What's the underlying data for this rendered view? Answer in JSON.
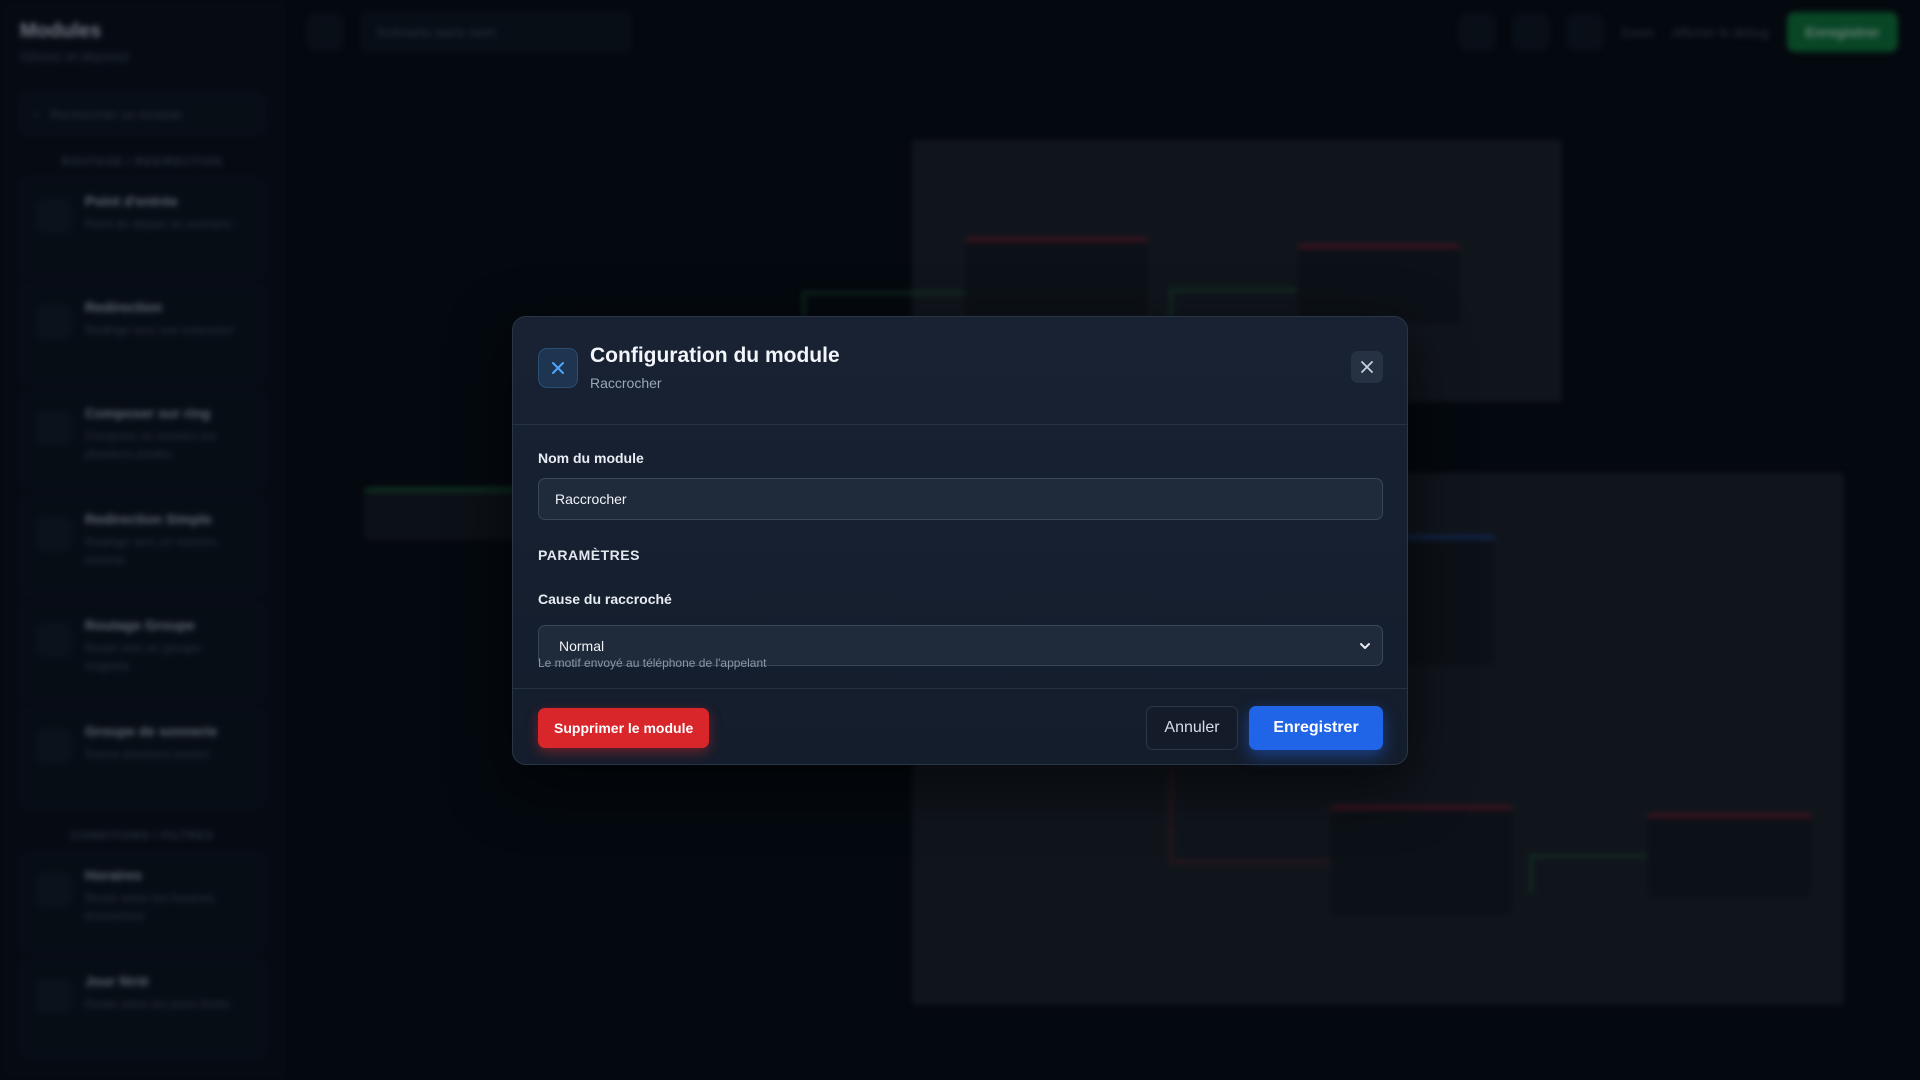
{
  "background": {
    "sidebar": {
      "title": "Modules",
      "subtitle": "Glissez et déposez",
      "search_placeholder": "Rechercher un module",
      "section_routing": "ROUTAGE / REDIRECTION",
      "section_conditions": "CONDITIONS / FILTRES",
      "items": [
        {
          "name": "Point d'entrée",
          "desc": "Point de départ du scénario"
        },
        {
          "name": "Redirection",
          "desc": "Redirige vers une extension"
        },
        {
          "name": "Composer sur ring",
          "desc": "Compose un numéro sur plusieurs postes"
        },
        {
          "name": "Redirection Simple",
          "desc": "Redirige vers un numéro externe"
        },
        {
          "name": "Routage Groupe",
          "desc": "Route vers un groupe d'agents"
        },
        {
          "name": "Groupe de sonnerie",
          "desc": "Sonne plusieurs postes"
        },
        {
          "name": "Horaires",
          "desc": "Route selon les horaires d'ouverture"
        },
        {
          "name": "Jour férié",
          "desc": "Route selon les jours fériés"
        }
      ]
    },
    "topbar": {
      "scenario_placeholder": "Scénario sans nom",
      "zoom": "Zoom",
      "debug": "Afficher le debug",
      "save": "Enregistrer"
    }
  },
  "modal": {
    "title": "Configuration du module",
    "subtitle": "Raccrocher",
    "name_label": "Nom du module",
    "name_value": "Raccrocher",
    "section_title": "PARAMÈTRES",
    "cause_label": "Cause du raccroché",
    "cause_value": "Normal",
    "cause_help": "Le motif envoyé au téléphone de l'appelant",
    "delete_button": "Supprimer le module",
    "cancel_button": "Annuler",
    "save_button": "Enregistrer"
  },
  "colors": {
    "accent": "#2064e8",
    "danger": "#d8262b",
    "badge_icon": "#4ea3ff"
  }
}
